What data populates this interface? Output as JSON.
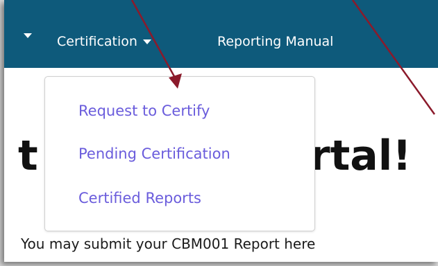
{
  "navbar": {
    "items": [
      {
        "label": ""
      },
      {
        "label": "Certification"
      },
      {
        "label": "Reporting Manual"
      }
    ]
  },
  "dropdown": {
    "items": [
      {
        "label": "Request to Certify"
      },
      {
        "label": "Pending Certification"
      },
      {
        "label": "Certified Reports"
      }
    ]
  },
  "hero": {
    "left_fragment": "t",
    "right_fragment": "rtal!"
  },
  "lead": {
    "text": "You may submit your CBM001 Report here"
  },
  "colors": {
    "navbar": "#0e5a7b",
    "dropdown_link": "#6a5cdc",
    "annotation_arrow": "#8b1a2b"
  }
}
